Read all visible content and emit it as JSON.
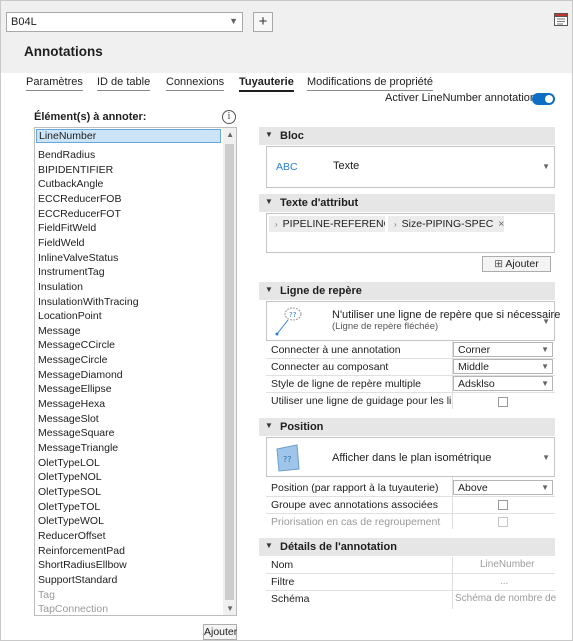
{
  "header": {
    "selector_value": "B04L",
    "title": "Annotations"
  },
  "tabs": [
    {
      "label": "Paramètres"
    },
    {
      "label": "ID de table"
    },
    {
      "label": "Connexions"
    },
    {
      "label": "Tuyauterie",
      "active": true
    },
    {
      "label": "Modifications de propriété"
    }
  ],
  "toggle": {
    "label": "Activer LineNumber annotations:",
    "on": true
  },
  "left_panel": {
    "label": "Élément(s) à annoter:",
    "selected": "LineNumber",
    "items": [
      "BendRadius",
      "BIPIDENTIFIER",
      "CutbackAngle",
      "ECCReducerFOB",
      "ECCReducerFOT",
      "FieldFitWeld",
      "FieldWeld",
      "InlineValveStatus",
      "InstrumentTag",
      "Insulation",
      "InsulationWithTracing",
      "LocationPoint",
      "Message",
      "MessageCCircle",
      "MessageCircle",
      "MessageDiamond",
      "MessageEllipse",
      "MessageHexa",
      "MessageSlot",
      "MessageSquare",
      "MessageTriangle",
      "OletTypeLOL",
      "OletTypeNOL",
      "OletTypeSOL",
      "OletTypeTOL",
      "OletTypeWOL",
      "ReducerOffset",
      "ReinforcementPad",
      "ShortRadiusEllbow",
      "SupportStandard"
    ],
    "disabled_items": [
      "Tag",
      "TapConnection"
    ],
    "add_button": "Ajouter"
  },
  "bloc": {
    "header": "Bloc",
    "icon_text": "ABC",
    "value": "Texte"
  },
  "texte_attribut": {
    "header": "Texte d'attribut",
    "chips": [
      "PIPELINE-REFERENCE-",
      "Size-PIPING-SPEC"
    ],
    "add_button": "Ajouter"
  },
  "ligne_repere": {
    "header": "Ligne de repère",
    "main_text": "N'utiliser une ligne de repère que si nécessaire",
    "sub_text": "(Ligne de repère fléchée)",
    "rows": [
      {
        "label": "Connecter à une annotation",
        "value": "Corner"
      },
      {
        "label": "Connecter au composant",
        "value": "Middle"
      },
      {
        "label": "Style de ligne de repère multiple",
        "value": "Adsklso"
      },
      {
        "label": "Utiliser une ligne de guidage pour les lignes",
        "checked": false
      }
    ]
  },
  "position": {
    "header": "Position",
    "main_text": "Afficher dans le plan isométrique",
    "rows": [
      {
        "label": "Position (par rapport à la tuyauterie)",
        "value": "Above"
      },
      {
        "label": "Groupe avec annotations associées",
        "checked": false
      },
      {
        "label": "Priorisation en cas de regroupement",
        "checked": false
      }
    ]
  },
  "details": {
    "header": "Détails de l'annotation",
    "rows": [
      {
        "label": "Nom",
        "placeholder": "LineNumber"
      },
      {
        "label": "Filtre",
        "placeholder": "..."
      },
      {
        "label": "Schéma",
        "placeholder": "Schéma de nombre de"
      }
    ]
  },
  "colors": {
    "accent": "#0e6ec4",
    "selection": "#cce4f7",
    "section_bg": "#e6e6e6"
  }
}
